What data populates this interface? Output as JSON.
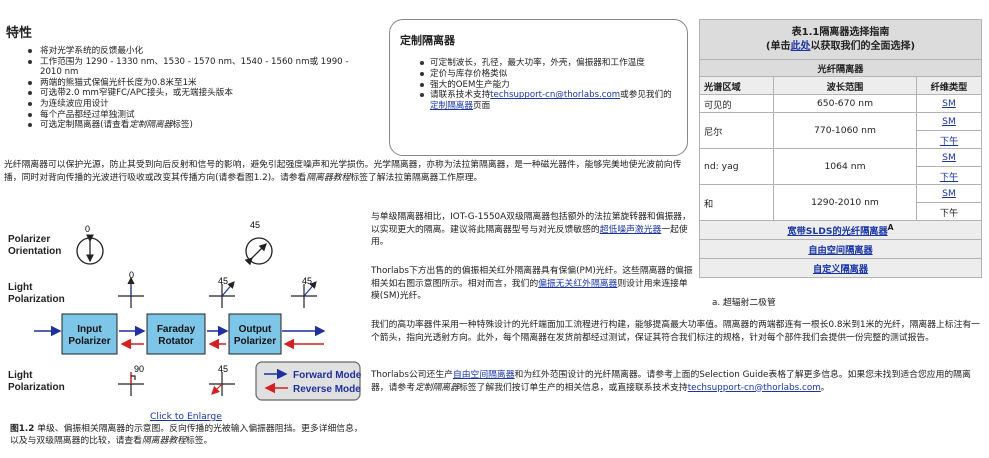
{
  "features": {
    "title": "特性",
    "items": [
      "将对光学系统的反馈最小化",
      "工作范围为 1290 - 1330 nm、1530 - 1570 nm、1540 - 1560 nm或 1990 - 2010 nm",
      "两端的熊猫式保偏光纤长度为0.8米至1米",
      "可选带2.0 mm窄键FC/APC接头，或无端接头版本",
      "为连续波应用设计",
      "每个产品都经过单独测试",
      "可选定制隔离器(请查看",
      "定制隔离器",
      "标签)"
    ]
  },
  "custom": {
    "title": "定制隔离器",
    "items": [
      "可定制波长，孔径，最大功率，外壳，偏振器和工作温度",
      "定价与库存价格类似",
      "强大的OEM生产能力",
      "请联系技术支持",
      "techsupport-cn@thorlabs.com",
      "或参见我们的",
      "定制隔离器",
      "页面"
    ]
  },
  "intro": {
    "text1": "光纤隔离器可以保护光源，防止其受到向后反射和信号的影响，避免引起强度噪声和光学损伤。光学隔离器，亦称为法拉第隔离器，是一种磁光器件，能够完美地使光波前向传播，同时对背向传播的光波进行吸收或改变其传播方向(请参看图1.2)。请参看",
    "link": "隔离器教程",
    "text2": "标签了解法拉第隔离器工作原理。"
  },
  "selection": {
    "title_line1": "表1.1隔离器选择指南",
    "title_line2_pre": "(单击",
    "title_line2_link": "此处",
    "title_line2_post": "以获取我们的全面选择)",
    "subtitle": "光纤隔离器",
    "col_region": "光谱区域",
    "col_range": "波长范围",
    "col_type": "纤维类型",
    "rows": [
      {
        "region": "可见的",
        "range": "650-670 nm",
        "types": [
          "SM"
        ]
      },
      {
        "region": "尼尔",
        "range": "770-1060 nm",
        "types": [
          "SM",
          "下午"
        ]
      },
      {
        "region": "nd: yag",
        "range": "1064 nm",
        "types": [
          "SM",
          "下午"
        ]
      },
      {
        "region": "和",
        "range": "1290-2010 nm",
        "types": [
          "SM",
          "下午"
        ]
      }
    ],
    "link_slds": "宽带SLDS的光纤隔离器",
    "link_slds_sup": "A",
    "link_free": "自由空间隔离器",
    "link_custom": "自定义隔离器",
    "footnote": "a. 超辐射二极管"
  },
  "diagram": {
    "polarizer_orientation": "Polarizer\nOrientation",
    "light_polarization": "Light\nPolarization",
    "input_polarizer": "Input\nPolarizer",
    "faraday_rotator": "Faraday\nRotator",
    "output_polarizer": "Output\nPolarizer",
    "forward_mode": "Forward Mode",
    "reverse_mode": "Reverse Mode",
    "angle_0": "0",
    "angle_45": "45",
    "angle_90": "90",
    "colors": {
      "box_fill": "#7dc6e8",
      "forward": "#1f2f9e",
      "reverse": "#d42020"
    }
  },
  "figure": {
    "enlarge": "Click to Enlarge",
    "label": "图1.2",
    "caption1": " 单级、偏振相关隔离器的示意图。反向传播的光被输入偏振器阻挡。更多详细信息，以及与双级隔离器的比较，请查看",
    "caption_link": "隔离器教程",
    "caption2": "标签。"
  },
  "paras": {
    "dual1": "与单级隔离器相比，IOT-G-1550A双级隔离器包括额外的法拉第旋转器和偏振器，以实现更大的隔离。建议将此隔离器型号与对光反馈敏感的",
    "dual_link": "超低噪声激光器",
    "dual2": "一起使用。",
    "pm1": "Thorlabs下方出售的的偏振相关红外隔离器具有保偏(PM)光纤。这些隔离器的偏振相关如右图示意图所示。相对而言，我们的",
    "pm_link": "偏振无关红外隔离器",
    "pm2": "则设计用来连接单模(SM)光纤。",
    "tech": "我们的高功率器件采用一种特殊设计的光纤端面加工流程进行构建，能够提高最大功率值。隔离器的两端都连有一根长0.8米到1米的光纤，隔离器上标注有一个箭头，指向光透射方向。此外，每个隔离器在发货前都经过测试，保证其符合我们标注的规格，针对每个部件我们会提供一份完整的测试报告。",
    "free1": "Thorlabs公司还生产",
    "free_link1": "自由空间隔离器",
    "free2": "和为红外范围设计的光纤隔离器。请参考上面的Selection Guide表格了解更多信息。如果您未找到适合您应用的隔离器，请参考",
    "free_italic": "定制隔离器",
    "free3": "标签了解我们按订单生产的相关信息，或直接联系技术支持",
    "free_link2": "techsupport-cn@thorlabs.com",
    "free4": "。"
  }
}
